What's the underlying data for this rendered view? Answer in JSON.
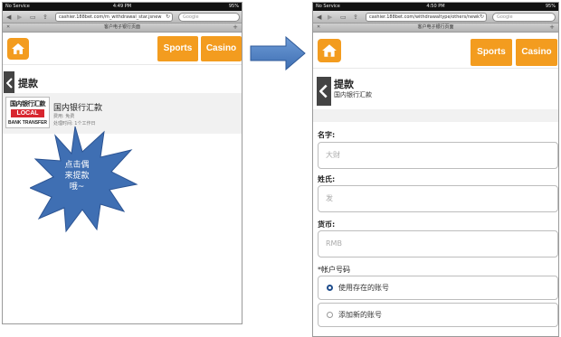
{
  "left": {
    "status": {
      "carrier": "No Service",
      "time": "4:49 PM",
      "battery": "95%"
    },
    "url": "cashier.188bet.com/m_withdrawal_star.jsnew",
    "search_placeholder": "Google",
    "tab_title": "客户电子银行页面",
    "nav": {
      "sports": "Sports",
      "casino": "Casino"
    },
    "page_title": "提款",
    "method": {
      "logo_top": "国内银行汇款",
      "logo_mid": "LOCAL",
      "logo_bottom": "BANK TRANSFER",
      "title": "国内银行汇款",
      "fee": "费用: 免费",
      "time": "处理时间: 1个工作日"
    },
    "callout": [
      "点击偶",
      "来提款",
      "哦~"
    ]
  },
  "right": {
    "status": {
      "carrier": "No Service",
      "time": "4:50 PM",
      "battery": "95%"
    },
    "url": "cashier.188bet.com/withdrawaltype/others/newk",
    "search_placeholder": "Google",
    "tab_title": "客户电子银行页面",
    "nav": {
      "sports": "Sports",
      "casino": "Casino"
    },
    "page_title": "提款",
    "page_subtitle": "国内银行汇款",
    "fields": {
      "first_name": {
        "label": "名字:",
        "placeholder": "大财"
      },
      "last_name": {
        "label": "姓氏:",
        "placeholder": "发"
      },
      "currency": {
        "label": "货币:",
        "placeholder": "RMB"
      }
    },
    "account": {
      "label": "*帐户号码",
      "option_existing": "使用存在的账号",
      "option_new": "添加新的账号"
    }
  },
  "colors": {
    "orange": "#f39c1f",
    "arrow_blue": "#4a7fc1",
    "burst_blue": "#3f6fb3"
  },
  "icons": [
    "home-icon",
    "back-chevron-icon",
    "arrow-right-icon",
    "reload-icon",
    "bookmarks-icon",
    "share-icon",
    "close-tab-icon",
    "new-tab-icon"
  ]
}
